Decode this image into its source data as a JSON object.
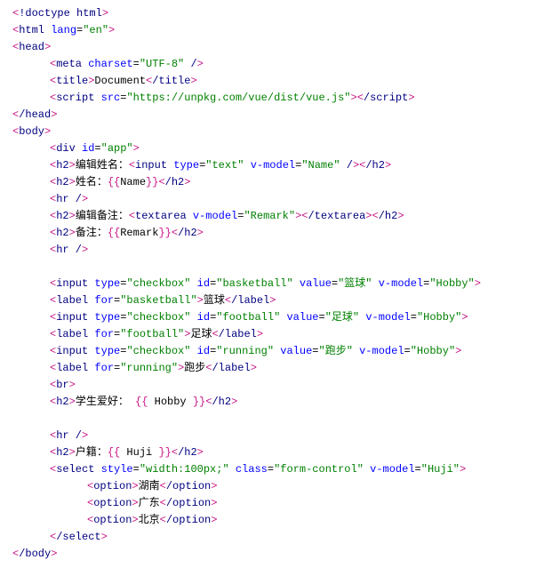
{
  "lines": [
    {
      "indent": 0,
      "parts": [
        [
          "punct",
          "<"
        ],
        [
          "tag",
          "!doctype html"
        ],
        [
          "punct",
          ">"
        ]
      ]
    },
    {
      "indent": 0,
      "parts": [
        [
          "punct",
          "<"
        ],
        [
          "tag",
          "html "
        ],
        [
          "attr",
          "lang"
        ],
        [
          "eq",
          "="
        ],
        [
          "val",
          "\"en\""
        ],
        [
          "punct",
          ">"
        ]
      ]
    },
    {
      "indent": 0,
      "parts": [
        [
          "punct",
          "<"
        ],
        [
          "tag",
          "head"
        ],
        [
          "punct",
          ">"
        ]
      ]
    },
    {
      "indent": 1,
      "parts": [
        [
          "punct",
          "<"
        ],
        [
          "tag",
          "meta "
        ],
        [
          "attr",
          "charset"
        ],
        [
          "eq",
          "="
        ],
        [
          "val",
          "\"UTF-8\""
        ],
        [
          "tag",
          " /"
        ],
        [
          "punct",
          ">"
        ]
      ]
    },
    {
      "indent": 1,
      "parts": [
        [
          "punct",
          "<"
        ],
        [
          "tag",
          "title"
        ],
        [
          "punct",
          ">"
        ],
        [
          "text",
          "Document"
        ],
        [
          "punct",
          "<"
        ],
        [
          "tag",
          "/title"
        ],
        [
          "punct",
          ">"
        ]
      ]
    },
    {
      "indent": 1,
      "parts": [
        [
          "punct",
          "<"
        ],
        [
          "tag",
          "script "
        ],
        [
          "attr",
          "src"
        ],
        [
          "eq",
          "="
        ],
        [
          "val",
          "\"https://unpkg.com/vue/dist/vue.js\""
        ],
        [
          "punct",
          ">"
        ],
        [
          "punct",
          "<"
        ],
        [
          "tag",
          "/script"
        ],
        [
          "punct",
          ">"
        ]
      ]
    },
    {
      "indent": 0,
      "parts": [
        [
          "punct",
          "<"
        ],
        [
          "tag",
          "/head"
        ],
        [
          "punct",
          ">"
        ]
      ]
    },
    {
      "indent": 0,
      "parts": [
        [
          "punct",
          "<"
        ],
        [
          "tag",
          "body"
        ],
        [
          "punct",
          ">"
        ]
      ]
    },
    {
      "indent": 1,
      "parts": [
        [
          "punct",
          "<"
        ],
        [
          "tag",
          "div "
        ],
        [
          "attr",
          "id"
        ],
        [
          "eq",
          "="
        ],
        [
          "val",
          "\"app\""
        ],
        [
          "punct",
          ">"
        ]
      ]
    },
    {
      "indent": 1,
      "parts": [
        [
          "punct",
          "<"
        ],
        [
          "tag",
          "h2"
        ],
        [
          "punct",
          ">"
        ],
        [
          "text",
          "编辑姓名："
        ],
        [
          "punct",
          "<"
        ],
        [
          "tag",
          "input "
        ],
        [
          "attr",
          "type"
        ],
        [
          "eq",
          "="
        ],
        [
          "val",
          "\"text\""
        ],
        [
          "tag",
          " "
        ],
        [
          "attr",
          "v-model"
        ],
        [
          "eq",
          "="
        ],
        [
          "val",
          "\"Name\""
        ],
        [
          "tag",
          " /"
        ],
        [
          "punct",
          ">"
        ],
        [
          "punct",
          "<"
        ],
        [
          "tag",
          "/h2"
        ],
        [
          "punct",
          ">"
        ]
      ]
    },
    {
      "indent": 1,
      "parts": [
        [
          "punct",
          "<"
        ],
        [
          "tag",
          "h2"
        ],
        [
          "punct",
          ">"
        ],
        [
          "text",
          "姓名："
        ],
        [
          "mustache",
          "{{"
        ],
        [
          "text",
          "Name"
        ],
        [
          "mustache",
          "}}"
        ],
        [
          "punct",
          "<"
        ],
        [
          "tag",
          "/h2"
        ],
        [
          "punct",
          ">"
        ]
      ]
    },
    {
      "indent": 1,
      "parts": [
        [
          "punct",
          "<"
        ],
        [
          "tag",
          "hr /"
        ],
        [
          "punct",
          ">"
        ]
      ]
    },
    {
      "indent": 1,
      "parts": [
        [
          "punct",
          "<"
        ],
        [
          "tag",
          "h2"
        ],
        [
          "punct",
          ">"
        ],
        [
          "text",
          "编辑备注："
        ],
        [
          "punct",
          "<"
        ],
        [
          "tag",
          "textarea "
        ],
        [
          "attr",
          "v-model"
        ],
        [
          "eq",
          "="
        ],
        [
          "val",
          "\"Remark\""
        ],
        [
          "punct",
          ">"
        ],
        [
          "punct",
          "<"
        ],
        [
          "tag",
          "/textarea"
        ],
        [
          "punct",
          ">"
        ],
        [
          "punct",
          "<"
        ],
        [
          "tag",
          "/h2"
        ],
        [
          "punct",
          ">"
        ]
      ]
    },
    {
      "indent": 1,
      "parts": [
        [
          "punct",
          "<"
        ],
        [
          "tag",
          "h2"
        ],
        [
          "punct",
          ">"
        ],
        [
          "text",
          "备注："
        ],
        [
          "mustache",
          "{{"
        ],
        [
          "text",
          "Remark"
        ],
        [
          "mustache",
          "}}"
        ],
        [
          "punct",
          "<"
        ],
        [
          "tag",
          "/h2"
        ],
        [
          "punct",
          ">"
        ]
      ]
    },
    {
      "indent": 1,
      "parts": [
        [
          "punct",
          "<"
        ],
        [
          "tag",
          "hr /"
        ],
        [
          "punct",
          ">"
        ]
      ]
    },
    {
      "blank": true
    },
    {
      "indent": 1,
      "parts": [
        [
          "punct",
          "<"
        ],
        [
          "tag",
          "input "
        ],
        [
          "attr",
          "type"
        ],
        [
          "eq",
          "="
        ],
        [
          "val",
          "\"checkbox\""
        ],
        [
          "tag",
          " "
        ],
        [
          "attr",
          "id"
        ],
        [
          "eq",
          "="
        ],
        [
          "val",
          "\"basketball\""
        ],
        [
          "tag",
          " "
        ],
        [
          "attr",
          "value"
        ],
        [
          "eq",
          "="
        ],
        [
          "val",
          "\"篮球\""
        ],
        [
          "tag",
          " "
        ],
        [
          "attr",
          "v-model"
        ],
        [
          "eq",
          "="
        ],
        [
          "val",
          "\"Hobby\""
        ],
        [
          "punct",
          ">"
        ]
      ]
    },
    {
      "indent": 1,
      "parts": [
        [
          "punct",
          "<"
        ],
        [
          "tag",
          "label "
        ],
        [
          "attr",
          "for"
        ],
        [
          "eq",
          "="
        ],
        [
          "val",
          "\"basketball\""
        ],
        [
          "punct",
          ">"
        ],
        [
          "text",
          "篮球"
        ],
        [
          "punct",
          "<"
        ],
        [
          "tag",
          "/label"
        ],
        [
          "punct",
          ">"
        ]
      ]
    },
    {
      "indent": 1,
      "parts": [
        [
          "punct",
          "<"
        ],
        [
          "tag",
          "input "
        ],
        [
          "attr",
          "type"
        ],
        [
          "eq",
          "="
        ],
        [
          "val",
          "\"checkbox\""
        ],
        [
          "tag",
          " "
        ],
        [
          "attr",
          "id"
        ],
        [
          "eq",
          "="
        ],
        [
          "val",
          "\"football\""
        ],
        [
          "tag",
          " "
        ],
        [
          "attr",
          "value"
        ],
        [
          "eq",
          "="
        ],
        [
          "val",
          "\"足球\""
        ],
        [
          "tag",
          " "
        ],
        [
          "attr",
          "v-model"
        ],
        [
          "eq",
          "="
        ],
        [
          "val",
          "\"Hobby\""
        ],
        [
          "punct",
          ">"
        ]
      ]
    },
    {
      "indent": 1,
      "parts": [
        [
          "punct",
          "<"
        ],
        [
          "tag",
          "label "
        ],
        [
          "attr",
          "for"
        ],
        [
          "eq",
          "="
        ],
        [
          "val",
          "\"football\""
        ],
        [
          "punct",
          ">"
        ],
        [
          "text",
          "足球"
        ],
        [
          "punct",
          "<"
        ],
        [
          "tag",
          "/label"
        ],
        [
          "punct",
          ">"
        ]
      ]
    },
    {
      "indent": 1,
      "parts": [
        [
          "punct",
          "<"
        ],
        [
          "tag",
          "input "
        ],
        [
          "attr",
          "type"
        ],
        [
          "eq",
          "="
        ],
        [
          "val",
          "\"checkbox\""
        ],
        [
          "tag",
          " "
        ],
        [
          "attr",
          "id"
        ],
        [
          "eq",
          "="
        ],
        [
          "val",
          "\"running\""
        ],
        [
          "tag",
          " "
        ],
        [
          "attr",
          "value"
        ],
        [
          "eq",
          "="
        ],
        [
          "val",
          "\"跑步\""
        ],
        [
          "tag",
          " "
        ],
        [
          "attr",
          "v-model"
        ],
        [
          "eq",
          "="
        ],
        [
          "val",
          "\"Hobby\""
        ],
        [
          "punct",
          ">"
        ]
      ]
    },
    {
      "indent": 1,
      "parts": [
        [
          "punct",
          "<"
        ],
        [
          "tag",
          "label "
        ],
        [
          "attr",
          "for"
        ],
        [
          "eq",
          "="
        ],
        [
          "val",
          "\"running\""
        ],
        [
          "punct",
          ">"
        ],
        [
          "text",
          "跑步"
        ],
        [
          "punct",
          "<"
        ],
        [
          "tag",
          "/label"
        ],
        [
          "punct",
          ">"
        ]
      ]
    },
    {
      "indent": 1,
      "parts": [
        [
          "punct",
          "<"
        ],
        [
          "tag",
          "br"
        ],
        [
          "punct",
          ">"
        ]
      ]
    },
    {
      "indent": 1,
      "parts": [
        [
          "punct",
          "<"
        ],
        [
          "tag",
          "h2"
        ],
        [
          "punct",
          ">"
        ],
        [
          "text",
          "学生爱好： "
        ],
        [
          "mustache",
          "{{"
        ],
        [
          "text",
          " Hobby "
        ],
        [
          "mustache",
          "}}"
        ],
        [
          "punct",
          "<"
        ],
        [
          "tag",
          "/h2"
        ],
        [
          "punct",
          ">"
        ]
      ]
    },
    {
      "blank": true
    },
    {
      "indent": 1,
      "parts": [
        [
          "punct",
          "<"
        ],
        [
          "tag",
          "hr /"
        ],
        [
          "punct",
          ">"
        ]
      ]
    },
    {
      "indent": 1,
      "parts": [
        [
          "punct",
          "<"
        ],
        [
          "tag",
          "h2"
        ],
        [
          "punct",
          ">"
        ],
        [
          "text",
          "户籍："
        ],
        [
          "mustache",
          "{{"
        ],
        [
          "text",
          " Huji "
        ],
        [
          "mustache",
          "}}"
        ],
        [
          "punct",
          "<"
        ],
        [
          "tag",
          "/h2"
        ],
        [
          "punct",
          ">"
        ]
      ]
    },
    {
      "indent": 1,
      "parts": [
        [
          "punct",
          "<"
        ],
        [
          "tag",
          "select "
        ],
        [
          "attr",
          "style"
        ],
        [
          "eq",
          "="
        ],
        [
          "val",
          "\"width:100px;\""
        ],
        [
          "tag",
          " "
        ],
        [
          "attr",
          "class"
        ],
        [
          "eq",
          "="
        ],
        [
          "val",
          "\"form-control\""
        ],
        [
          "tag",
          " "
        ],
        [
          "attr",
          "v-model"
        ],
        [
          "eq",
          "="
        ],
        [
          "val",
          "\"Huji\""
        ],
        [
          "punct",
          ">"
        ]
      ]
    },
    {
      "indent": 2,
      "parts": [
        [
          "punct",
          "<"
        ],
        [
          "tag",
          "option"
        ],
        [
          "punct",
          ">"
        ],
        [
          "text",
          "湖南"
        ],
        [
          "punct",
          "<"
        ],
        [
          "tag",
          "/option"
        ],
        [
          "punct",
          ">"
        ]
      ]
    },
    {
      "indent": 2,
      "parts": [
        [
          "punct",
          "<"
        ],
        [
          "tag",
          "option"
        ],
        [
          "punct",
          ">"
        ],
        [
          "text",
          "广东"
        ],
        [
          "punct",
          "<"
        ],
        [
          "tag",
          "/option"
        ],
        [
          "punct",
          ">"
        ]
      ]
    },
    {
      "indent": 2,
      "parts": [
        [
          "punct",
          "<"
        ],
        [
          "tag",
          "option"
        ],
        [
          "punct",
          ">"
        ],
        [
          "text",
          "北京"
        ],
        [
          "punct",
          "<"
        ],
        [
          "tag",
          "/option"
        ],
        [
          "punct",
          ">"
        ]
      ]
    },
    {
      "indent": 1,
      "parts": [
        [
          "punct",
          "<"
        ],
        [
          "tag",
          "/select"
        ],
        [
          "punct",
          ">"
        ]
      ]
    },
    {
      "indent": 0,
      "parts": [
        [
          "punct",
          "<"
        ],
        [
          "tag",
          "/body"
        ],
        [
          "punct",
          ">"
        ]
      ]
    }
  ]
}
